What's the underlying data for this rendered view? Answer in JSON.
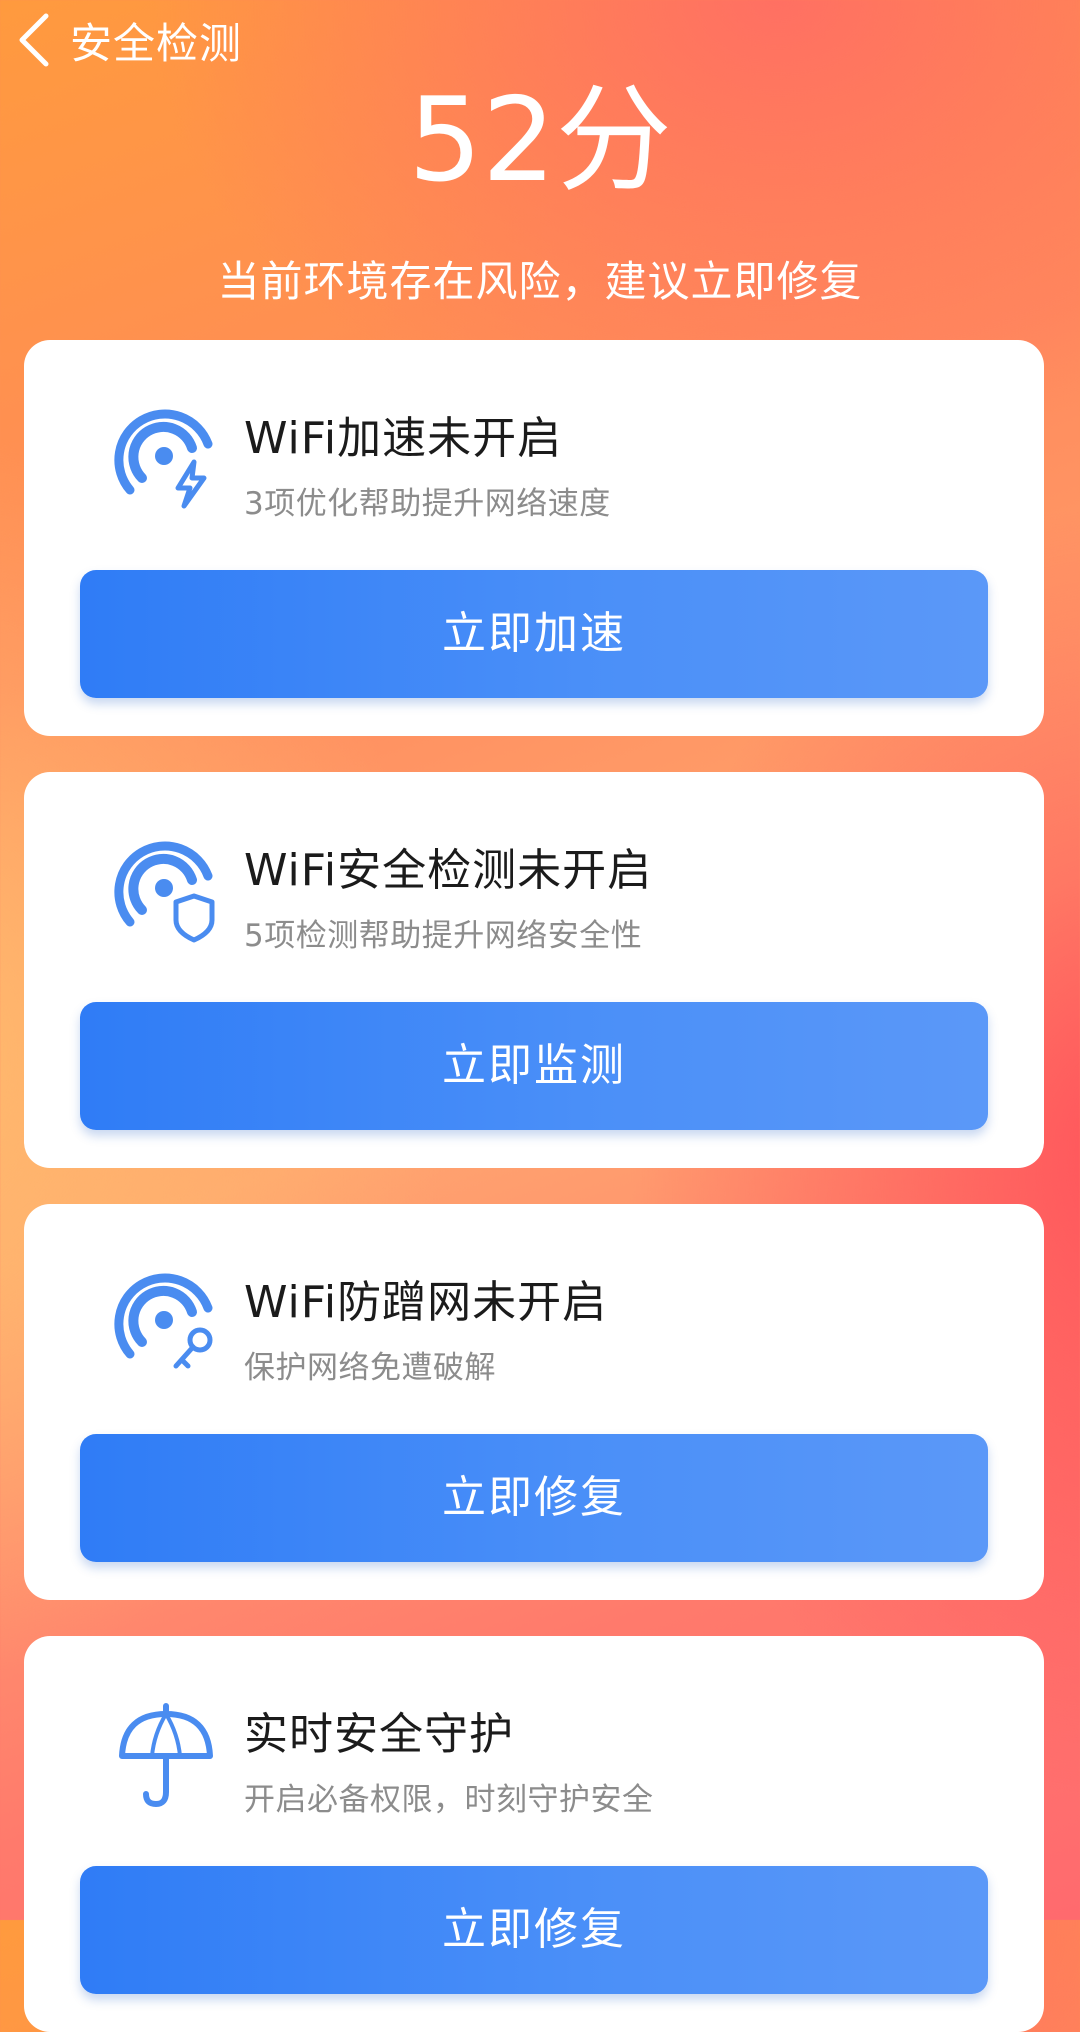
{
  "header": {
    "back_icon": "chevron-left-icon",
    "title": "安全检测"
  },
  "score": {
    "value": "52分",
    "message": "当前环境存在风险，建议立即修复"
  },
  "colors": {
    "accent_blue": "#2f7cf6",
    "icon_blue": "#4a8cf0"
  },
  "cards": [
    {
      "icon": "wifi-boost-icon",
      "title": "WiFi加速未开启",
      "desc": "3项优化帮助提升网络速度",
      "button": "立即加速"
    },
    {
      "icon": "wifi-shield-icon",
      "title": "WiFi安全检测未开启",
      "desc": "5项检测帮助提升网络安全性",
      "button": "立即监测"
    },
    {
      "icon": "wifi-key-icon",
      "title": "WiFi防蹭网未开启",
      "desc": "保护网络免遭破解",
      "button": "立即修复"
    },
    {
      "icon": "umbrella-icon",
      "title": "实时安全守护",
      "desc": "开启必备权限，时刻守护安全",
      "button": "立即修复"
    }
  ]
}
